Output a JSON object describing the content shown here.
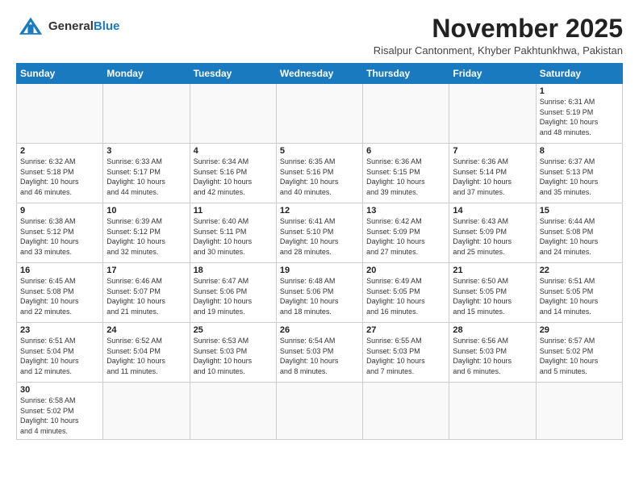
{
  "logo": {
    "line1": "General",
    "line2": "Blue"
  },
  "header": {
    "month_title": "November 2025",
    "subtitle": "Risalpur Cantonment, Khyber Pakhtunkhwa, Pakistan"
  },
  "weekdays": [
    "Sunday",
    "Monday",
    "Tuesday",
    "Wednesday",
    "Thursday",
    "Friday",
    "Saturday"
  ],
  "weeks": [
    [
      {
        "day": "",
        "info": ""
      },
      {
        "day": "",
        "info": ""
      },
      {
        "day": "",
        "info": ""
      },
      {
        "day": "",
        "info": ""
      },
      {
        "day": "",
        "info": ""
      },
      {
        "day": "",
        "info": ""
      },
      {
        "day": "1",
        "info": "Sunrise: 6:31 AM\nSunset: 5:19 PM\nDaylight: 10 hours\nand 48 minutes."
      }
    ],
    [
      {
        "day": "2",
        "info": "Sunrise: 6:32 AM\nSunset: 5:18 PM\nDaylight: 10 hours\nand 46 minutes."
      },
      {
        "day": "3",
        "info": "Sunrise: 6:33 AM\nSunset: 5:17 PM\nDaylight: 10 hours\nand 44 minutes."
      },
      {
        "day": "4",
        "info": "Sunrise: 6:34 AM\nSunset: 5:16 PM\nDaylight: 10 hours\nand 42 minutes."
      },
      {
        "day": "5",
        "info": "Sunrise: 6:35 AM\nSunset: 5:16 PM\nDaylight: 10 hours\nand 40 minutes."
      },
      {
        "day": "6",
        "info": "Sunrise: 6:36 AM\nSunset: 5:15 PM\nDaylight: 10 hours\nand 39 minutes."
      },
      {
        "day": "7",
        "info": "Sunrise: 6:36 AM\nSunset: 5:14 PM\nDaylight: 10 hours\nand 37 minutes."
      },
      {
        "day": "8",
        "info": "Sunrise: 6:37 AM\nSunset: 5:13 PM\nDaylight: 10 hours\nand 35 minutes."
      }
    ],
    [
      {
        "day": "9",
        "info": "Sunrise: 6:38 AM\nSunset: 5:12 PM\nDaylight: 10 hours\nand 33 minutes."
      },
      {
        "day": "10",
        "info": "Sunrise: 6:39 AM\nSunset: 5:12 PM\nDaylight: 10 hours\nand 32 minutes."
      },
      {
        "day": "11",
        "info": "Sunrise: 6:40 AM\nSunset: 5:11 PM\nDaylight: 10 hours\nand 30 minutes."
      },
      {
        "day": "12",
        "info": "Sunrise: 6:41 AM\nSunset: 5:10 PM\nDaylight: 10 hours\nand 28 minutes."
      },
      {
        "day": "13",
        "info": "Sunrise: 6:42 AM\nSunset: 5:09 PM\nDaylight: 10 hours\nand 27 minutes."
      },
      {
        "day": "14",
        "info": "Sunrise: 6:43 AM\nSunset: 5:09 PM\nDaylight: 10 hours\nand 25 minutes."
      },
      {
        "day": "15",
        "info": "Sunrise: 6:44 AM\nSunset: 5:08 PM\nDaylight: 10 hours\nand 24 minutes."
      }
    ],
    [
      {
        "day": "16",
        "info": "Sunrise: 6:45 AM\nSunset: 5:08 PM\nDaylight: 10 hours\nand 22 minutes."
      },
      {
        "day": "17",
        "info": "Sunrise: 6:46 AM\nSunset: 5:07 PM\nDaylight: 10 hours\nand 21 minutes."
      },
      {
        "day": "18",
        "info": "Sunrise: 6:47 AM\nSunset: 5:06 PM\nDaylight: 10 hours\nand 19 minutes."
      },
      {
        "day": "19",
        "info": "Sunrise: 6:48 AM\nSunset: 5:06 PM\nDaylight: 10 hours\nand 18 minutes."
      },
      {
        "day": "20",
        "info": "Sunrise: 6:49 AM\nSunset: 5:05 PM\nDaylight: 10 hours\nand 16 minutes."
      },
      {
        "day": "21",
        "info": "Sunrise: 6:50 AM\nSunset: 5:05 PM\nDaylight: 10 hours\nand 15 minutes."
      },
      {
        "day": "22",
        "info": "Sunrise: 6:51 AM\nSunset: 5:05 PM\nDaylight: 10 hours\nand 14 minutes."
      }
    ],
    [
      {
        "day": "23",
        "info": "Sunrise: 6:51 AM\nSunset: 5:04 PM\nDaylight: 10 hours\nand 12 minutes."
      },
      {
        "day": "24",
        "info": "Sunrise: 6:52 AM\nSunset: 5:04 PM\nDaylight: 10 hours\nand 11 minutes."
      },
      {
        "day": "25",
        "info": "Sunrise: 6:53 AM\nSunset: 5:03 PM\nDaylight: 10 hours\nand 10 minutes."
      },
      {
        "day": "26",
        "info": "Sunrise: 6:54 AM\nSunset: 5:03 PM\nDaylight: 10 hours\nand 8 minutes."
      },
      {
        "day": "27",
        "info": "Sunrise: 6:55 AM\nSunset: 5:03 PM\nDaylight: 10 hours\nand 7 minutes."
      },
      {
        "day": "28",
        "info": "Sunrise: 6:56 AM\nSunset: 5:03 PM\nDaylight: 10 hours\nand 6 minutes."
      },
      {
        "day": "29",
        "info": "Sunrise: 6:57 AM\nSunset: 5:02 PM\nDaylight: 10 hours\nand 5 minutes."
      }
    ],
    [
      {
        "day": "30",
        "info": "Sunrise: 6:58 AM\nSunset: 5:02 PM\nDaylight: 10 hours\nand 4 minutes."
      },
      {
        "day": "",
        "info": ""
      },
      {
        "day": "",
        "info": ""
      },
      {
        "day": "",
        "info": ""
      },
      {
        "day": "",
        "info": ""
      },
      {
        "day": "",
        "info": ""
      },
      {
        "day": "",
        "info": ""
      }
    ]
  ],
  "colors": {
    "header_bg": "#1a7abf",
    "logo_blue": "#1a7abf"
  }
}
